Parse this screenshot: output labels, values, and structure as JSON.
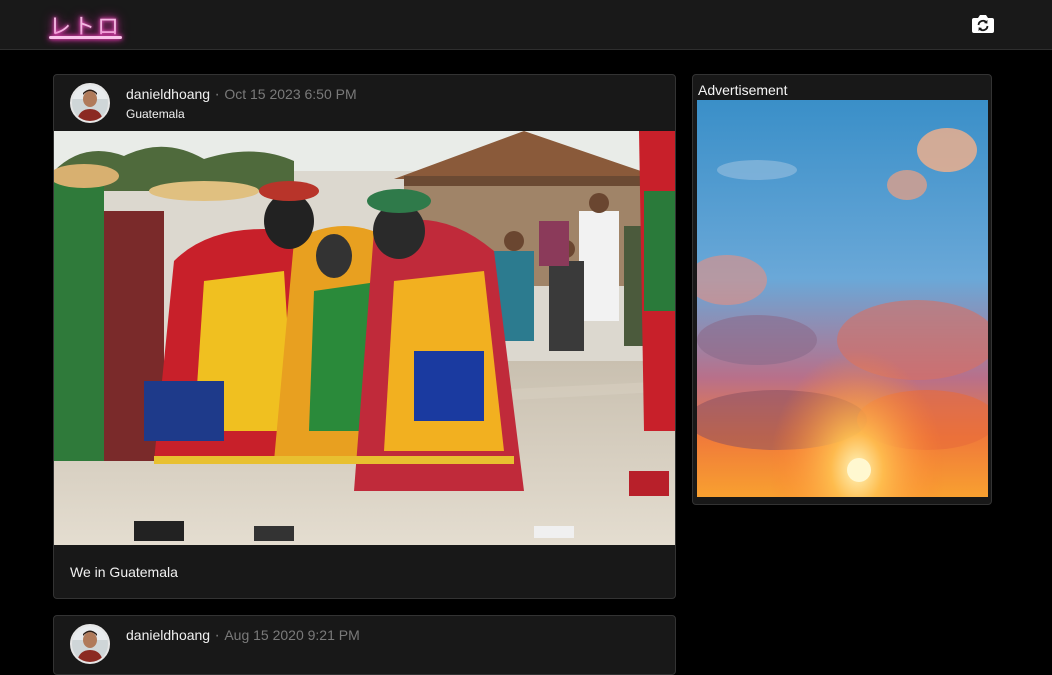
{
  "app": {
    "logo_text": "レトロ"
  },
  "header": {
    "camera_icon": "camera-rotate-icon"
  },
  "posts": [
    {
      "username": "danieldhoang",
      "separator": "·",
      "timestamp": "Oct 15 2023 6:50 PM",
      "location": "Guatemala",
      "photo": "festival-dancers-costumes-photo",
      "caption": "We in Guatemala"
    },
    {
      "username": "danieldhoang",
      "separator": "·",
      "timestamp": "Aug 15 2020 9:21 PM"
    }
  ],
  "sidebar": {
    "ad_title": "Advertisement",
    "ad_image": "sunset-sky-photo"
  },
  "colors": {
    "neon_pink": "#ff3cbf",
    "bg": "#000000",
    "card": "#181818"
  }
}
